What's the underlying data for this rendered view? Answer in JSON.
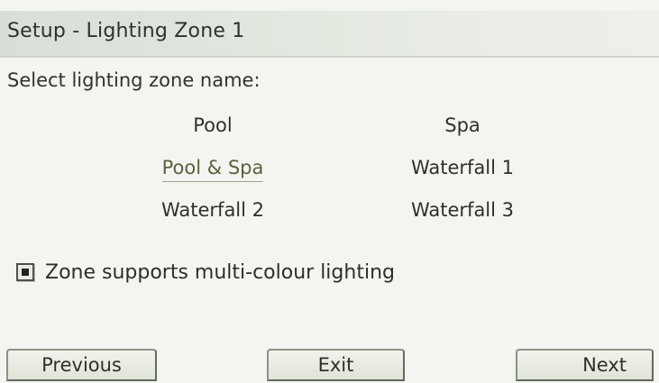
{
  "header": {
    "title": "Setup - Lighting Zone 1"
  },
  "content": {
    "prompt": "Select lighting zone name:",
    "zone_options": [
      {
        "label": "Pool",
        "selected": false
      },
      {
        "label": "Spa",
        "selected": false
      },
      {
        "label": "Pool & Spa",
        "selected": true
      },
      {
        "label": "Waterfall 1",
        "selected": false
      },
      {
        "label": "Waterfall 2",
        "selected": false
      },
      {
        "label": "Waterfall 3",
        "selected": false
      }
    ],
    "multicolour_checkbox": {
      "label": "Zone supports multi-colour lighting",
      "checked": true
    }
  },
  "footer": {
    "previous_label": "Previous",
    "exit_label": "Exit",
    "next_label": "Next"
  },
  "colors": {
    "background": "#f4f5f0",
    "title_bar": "#e2e7de",
    "selected_text": "#58613f",
    "text": "#2c322a"
  }
}
